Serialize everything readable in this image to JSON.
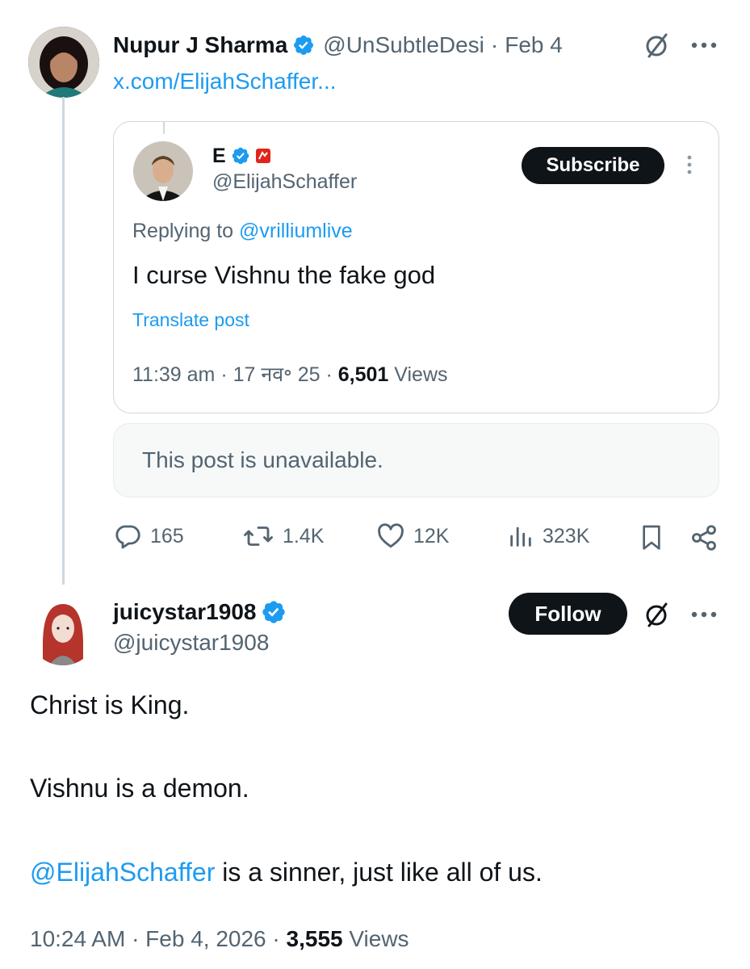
{
  "post1": {
    "author_name": "Nupur J Sharma",
    "handle": "@UnSubtleDesi",
    "separator": "·",
    "date": "Feb 4",
    "link_text": "x.com/ElijahSchaffer...",
    "quote": {
      "author_name": "E",
      "handle": "@ElijahSchaffer",
      "subscribe_label": "Subscribe",
      "replying_prefix": "Replying to ",
      "replying_handle": "@vrilliumlive",
      "text": "I curse Vishnu the fake god",
      "translate_label": "Translate post",
      "meta_time": "11:39 am · 17 नव॰ 25 · ",
      "meta_views_count": "6,501",
      "meta_views_label": " Views"
    },
    "unavailable_text": "This post is unavailable.",
    "actions": {
      "replies": "165",
      "reposts": "1.4K",
      "likes": "12K",
      "views": "323K"
    }
  },
  "post2": {
    "author_name": "juicystar1908",
    "handle": "@juicystar1908",
    "follow_label": "Follow",
    "line1": "Christ is King.",
    "line2": "Vishnu is a demon.",
    "line3_mention": "@ElijahSchaffer",
    "line3_rest": " is a sinner, just like all of us.",
    "meta_time": "10:24 AM · Feb 4, 2026 · ",
    "meta_views_count": "3,555",
    "meta_views_label": " Views"
  },
  "icons": {
    "verified": "verified-badge-icon",
    "grok": "grok-icon",
    "more": "more-icon",
    "reply": "reply-icon",
    "repost": "repost-icon",
    "like": "like-icon",
    "views": "views-icon",
    "bookmark": "bookmark-icon",
    "share": "share-icon"
  },
  "colors": {
    "accent": "#1d9bf0",
    "text": "#0f1419",
    "muted": "#536471"
  }
}
